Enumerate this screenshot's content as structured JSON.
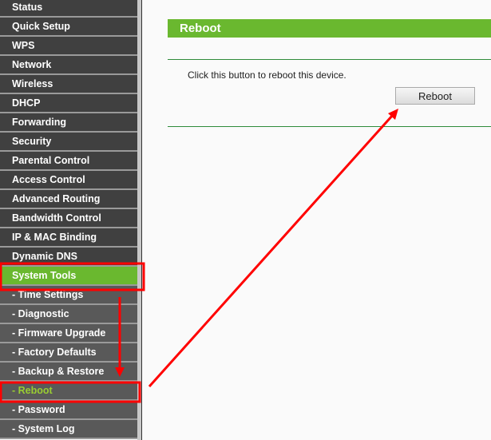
{
  "sidebar": {
    "items": [
      {
        "label": "Status"
      },
      {
        "label": "Quick Setup"
      },
      {
        "label": "WPS"
      },
      {
        "label": "Network"
      },
      {
        "label": "Wireless"
      },
      {
        "label": "DHCP"
      },
      {
        "label": "Forwarding"
      },
      {
        "label": "Security"
      },
      {
        "label": "Parental Control"
      },
      {
        "label": "Access Control"
      },
      {
        "label": "Advanced Routing"
      },
      {
        "label": "Bandwidth Control"
      },
      {
        "label": "IP & MAC Binding"
      },
      {
        "label": "Dynamic DNS"
      },
      {
        "label": "System Tools"
      },
      {
        "label": "- Time Settings"
      },
      {
        "label": "- Diagnostic"
      },
      {
        "label": "- Firmware Upgrade"
      },
      {
        "label": "- Factory Defaults"
      },
      {
        "label": "- Backup & Restore"
      },
      {
        "label": "- Reboot"
      },
      {
        "label": "- Password"
      },
      {
        "label": "- System Log"
      }
    ]
  },
  "main": {
    "title": "Reboot",
    "message": "Click this button to reboot this device.",
    "button_label": "Reboot"
  },
  "colors": {
    "accent": "#6ab82f",
    "annotation": "#ff0000"
  }
}
